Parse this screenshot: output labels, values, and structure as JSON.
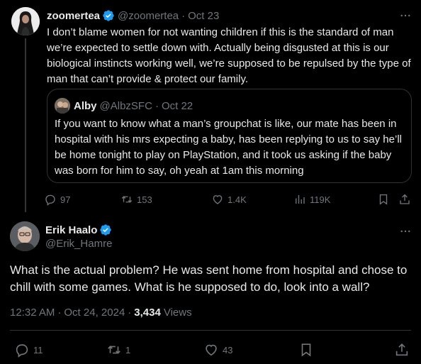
{
  "tweet1": {
    "display_name": "zoomertea",
    "handle": "@zoomertea",
    "date": "Oct 23",
    "separator": "·",
    "text": "I don’t blame women for not wanting children if this is the standard of man we’re expected to settle down with. Actually being disgusted at this is our biological instincts working well, we’re supposed to be repulsed by the type of man that can’t provide & protect our family.",
    "quote": {
      "display_name": "Alby",
      "handle": "@AlbzSFC",
      "date": "Oct 22",
      "text": "If you want to know what a man’s groupchat is like, our mate has been in hospital with his mrs expecting a baby, has been replying to us to say he’ll be home tonight to play on PlayStation, and it took us asking if the baby was born for him to say, oh yeah at 1am this morning"
    },
    "stats": {
      "replies": "97",
      "reposts": "153",
      "likes": "1.4K",
      "views": "119K"
    }
  },
  "tweet2": {
    "display_name": "Erik Haalo",
    "handle": "@Erik_Hamre",
    "text": "What is the actual problem? He was sent home from hospital and chose to chill with some games. What is he supposed to do, look into a wall?",
    "time": "12:32 AM",
    "separator": "·",
    "date": "Oct 24, 2024",
    "views_count": "3,434",
    "views_label": "Views",
    "stats": {
      "replies": "11",
      "reposts": "1",
      "likes": "43"
    }
  },
  "colors": {
    "background": "#000000",
    "text": "#e7e9ea",
    "muted": "#71767b",
    "border": "#2f3336",
    "verified": "#1d9bf0"
  },
  "icons": [
    "more-icon",
    "verified-badge-icon",
    "reply-icon",
    "repost-icon",
    "like-icon",
    "views-icon",
    "bookmark-icon",
    "share-icon"
  ]
}
